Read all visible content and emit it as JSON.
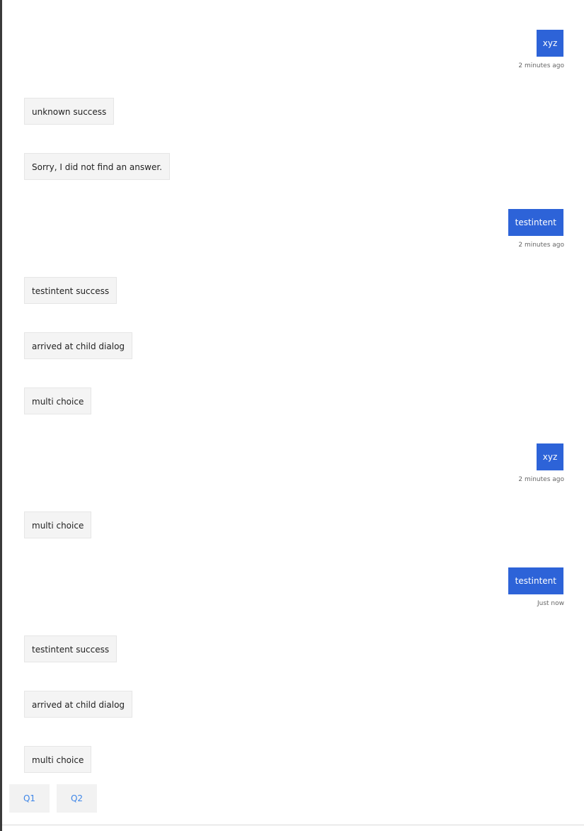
{
  "messages": [
    {
      "from": "user",
      "text": "xyz",
      "timestamp": "2 minutes ago"
    },
    {
      "from": "bot",
      "text": "unknown success"
    },
    {
      "from": "bot",
      "text": "Sorry, I did not find an answer."
    },
    {
      "from": "user",
      "text": "testintent",
      "timestamp": "2 minutes ago"
    },
    {
      "from": "bot",
      "text": "testintent success"
    },
    {
      "from": "bot",
      "text": "arrived at child dialog"
    },
    {
      "from": "bot",
      "text": "multi choice"
    },
    {
      "from": "user",
      "text": "xyz",
      "timestamp": "2 minutes ago"
    },
    {
      "from": "bot",
      "text": "multi choice"
    },
    {
      "from": "user",
      "text": "testintent",
      "timestamp": "Just now"
    },
    {
      "from": "bot",
      "text": "testintent success"
    },
    {
      "from": "bot",
      "text": "arrived at child dialog"
    },
    {
      "from": "bot",
      "text": "multi choice"
    }
  ],
  "suggested_actions": [
    "Q1",
    "Q2"
  ],
  "colors": {
    "user_bubble": "#2d63d8",
    "bot_bubble": "#f4f4f4",
    "action_text": "#3e86e8"
  }
}
